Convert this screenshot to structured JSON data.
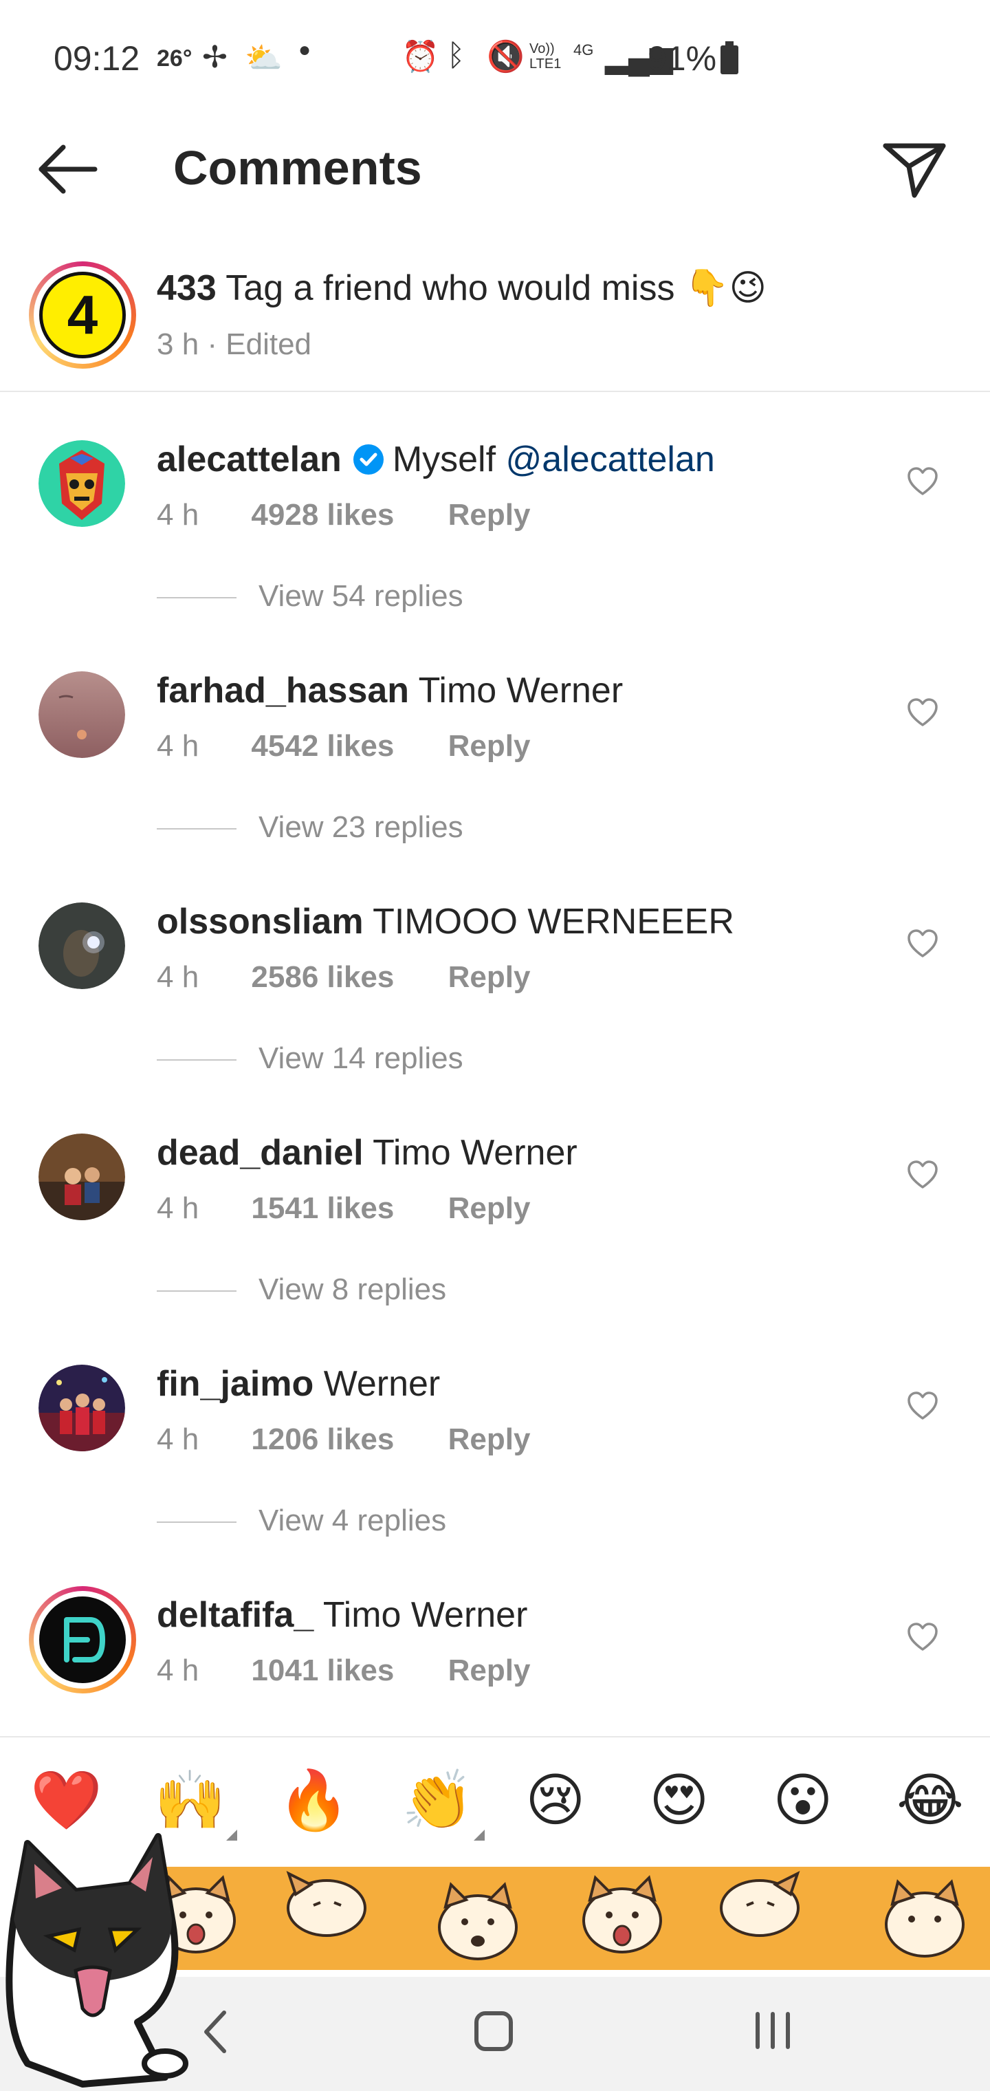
{
  "status_bar": {
    "time": "09:12",
    "temperature": "26°",
    "signal_text": "Vo)) LTE1",
    "network": "4G",
    "battery": "91%"
  },
  "header": {
    "title": "Comments"
  },
  "caption": {
    "avatar_label": "4",
    "username": "433",
    "text": "Tag a friend who would miss 👇😉",
    "meta": "3 h · Edited"
  },
  "comments": [
    {
      "username": "alecattelan",
      "verified": true,
      "text": "Myself",
      "mention": "@alecattelan",
      "time": "4 h",
      "likes": "4928 likes",
      "reply": "Reply",
      "replies": "View 54 replies"
    },
    {
      "username": "farhad_hassan",
      "text": "Timo Werner",
      "time": "4 h",
      "likes": "4542 likes",
      "reply": "Reply",
      "replies": "View 23 replies"
    },
    {
      "username": "olssonsliam",
      "text": "TIMOOO WERNEEER",
      "time": "4 h",
      "likes": "2586 likes",
      "reply": "Reply",
      "replies": "View 14 replies"
    },
    {
      "username": "dead_daniel",
      "text": "Timo Werner",
      "time": "4 h",
      "likes": "1541 likes",
      "reply": "Reply",
      "replies": "View 8 replies"
    },
    {
      "username": "fin_jaimo",
      "text": "Werner",
      "time": "4 h",
      "likes": "1206 likes",
      "reply": "Reply",
      "replies": "View 4 replies"
    },
    {
      "username": "deltafifa_",
      "text": "Timo Werner",
      "time": "4 h",
      "likes": "1041 likes",
      "reply": "Reply"
    }
  ],
  "emoji_bar": [
    "❤️",
    "🙌",
    "🔥",
    "👏",
    "😢",
    "😍",
    "😮",
    "😂"
  ],
  "colors": {
    "text": "#262626",
    "secondary": "#8e8e8e",
    "mention": "#00376b",
    "verified": "#0095f6",
    "banner": "#f5ad3c"
  }
}
